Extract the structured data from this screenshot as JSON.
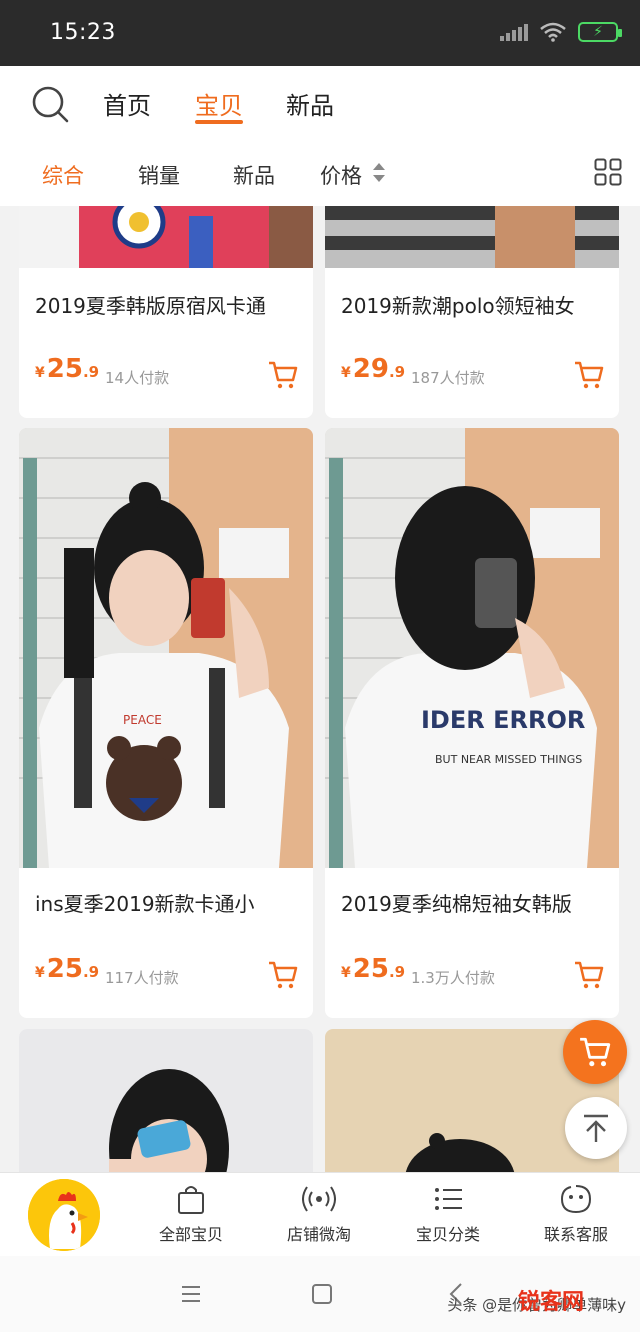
{
  "status_bar": {
    "time": "15:23"
  },
  "top_nav": {
    "tabs": [
      "首页",
      "宝贝",
      "新品"
    ],
    "active_tab": "宝贝"
  },
  "sort_bar": {
    "items": [
      "综合",
      "销量",
      "新品",
      "价格"
    ],
    "active": "综合"
  },
  "products": [
    {
      "title": "2019夏季韩版原宿风卡通",
      "price_int": "25",
      "price_dec": ".9",
      "currency": "¥",
      "sold": "14人付款"
    },
    {
      "title": "2019新款潮polo领短袖女",
      "price_int": "29",
      "price_dec": ".9",
      "currency": "¥",
      "sold": "187人付款"
    },
    {
      "title": "ins夏季2019新款卡通小",
      "price_int": "25",
      "price_dec": ".9",
      "currency": "¥",
      "sold": "117人付款"
    },
    {
      "title": "2019夏季纯棉短袖女韩版",
      "price_int": "25",
      "price_dec": ".9",
      "currency": "¥",
      "sold": "1.3万人付款"
    }
  ],
  "shop_bar": {
    "items": [
      {
        "label": "全部宝贝",
        "icon": "shopping-bag-icon"
      },
      {
        "label": "店铺微淘",
        "icon": "broadcast-icon"
      },
      {
        "label": "宝贝分类",
        "icon": "list-icon"
      },
      {
        "label": "联系客服",
        "icon": "chat-face-icon"
      }
    ]
  },
  "print_overlay": {
    "watermark": "头条 @是你曾为卿单薄味y",
    "brand": "锐客网"
  },
  "colors": {
    "accent": "#ef6c1f",
    "status_bar": "#2b2b2b",
    "logo_bg": "#fcc60b"
  }
}
